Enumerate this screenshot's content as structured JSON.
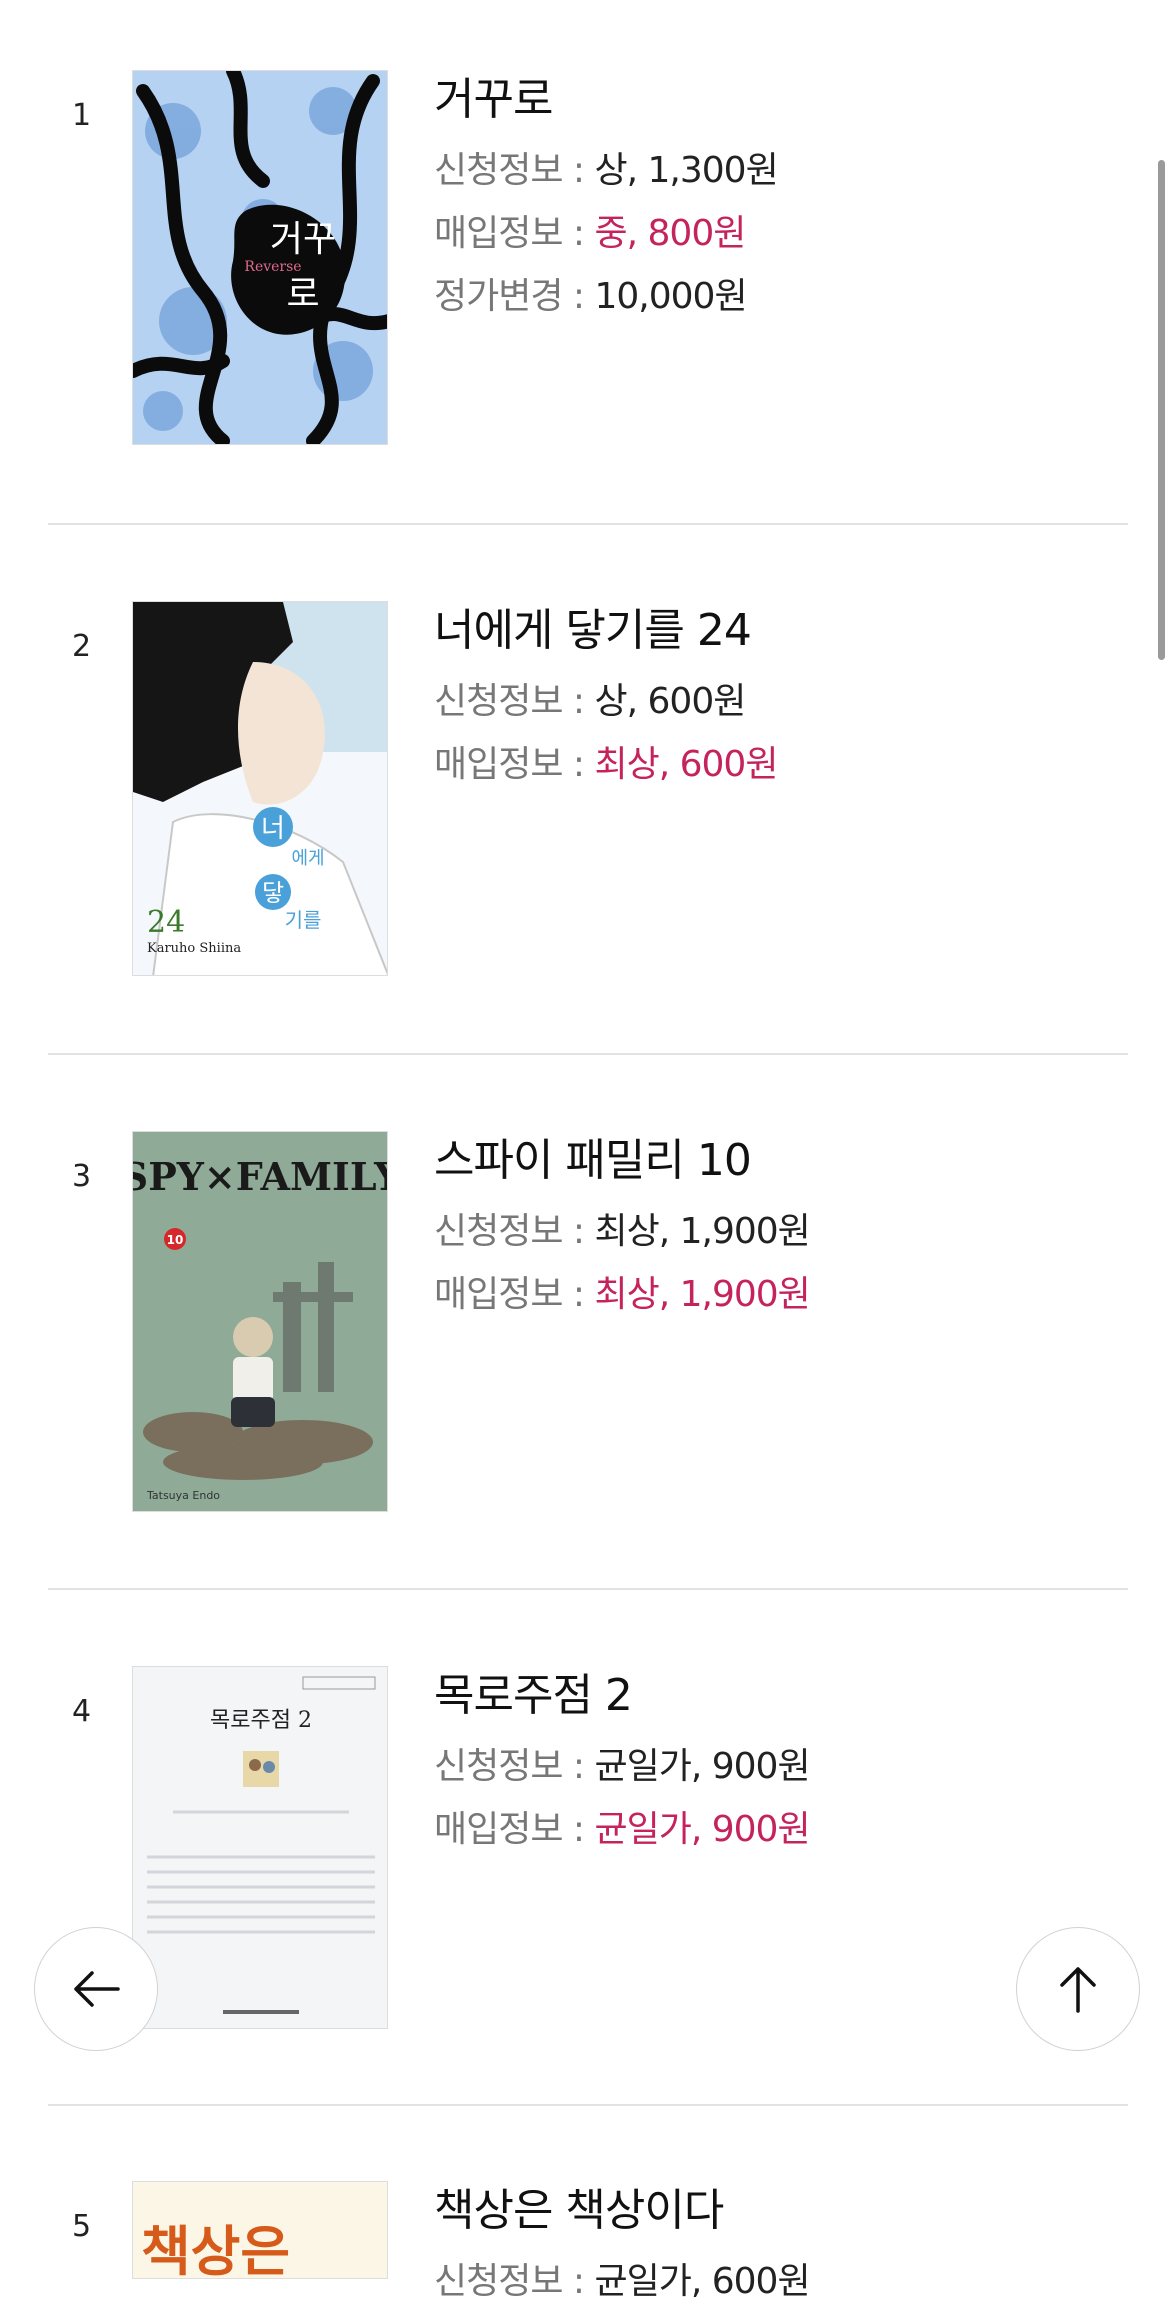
{
  "books": [
    {
      "rank": "1",
      "title": "거꾸로",
      "apply_label": "신청정보 : ",
      "apply_value": "상, 1,300원",
      "buy_label": "매입정보 : ",
      "buy_value": "중, 800원",
      "price_label": "정가변경 : ",
      "price_value": "10,000원",
      "cover": {
        "title_chars": "거꾸로",
        "subtitle": "Reverse"
      }
    },
    {
      "rank": "2",
      "title": "너에게 닿기를 24",
      "apply_label": "신청정보 : ",
      "apply_value": "상, 600원",
      "buy_label": "매입정보 : ",
      "buy_value": "최상, 600원",
      "cover": {
        "volume": "24",
        "author": "Karuho Shiina",
        "title_chars": [
          "너",
          "에",
          "게",
          "닿",
          "기",
          "를"
        ]
      }
    },
    {
      "rank": "3",
      "title": "스파이 패밀리 10",
      "apply_label": "신청정보 : ",
      "apply_value": "최상, 1,900원",
      "buy_label": "매입정보 : ",
      "buy_value": "최상, 1,900원",
      "cover": {
        "logo": "SPY×FAMILY",
        "volume": "10",
        "author": "Tatsuya Endo"
      }
    },
    {
      "rank": "4",
      "title": "목로주점 2",
      "apply_label": "신청정보 : ",
      "apply_value": "균일가, 900원",
      "buy_label": "매입정보 : ",
      "buy_value": "균일가, 900원",
      "cover": {
        "title": "목로주점 2"
      }
    },
    {
      "rank": "5",
      "title": "책상은 책상이다",
      "apply_label": "신청정보 : ",
      "apply_value": "균일가, 600원",
      "cover": {
        "title": "책상은"
      }
    }
  ],
  "buttons": {
    "back_icon": "arrow-left-icon",
    "top_icon": "arrow-up-icon"
  },
  "colors": {
    "buy_price": "#c4235c",
    "label": "#777777",
    "separator": "#e2e2e2"
  }
}
